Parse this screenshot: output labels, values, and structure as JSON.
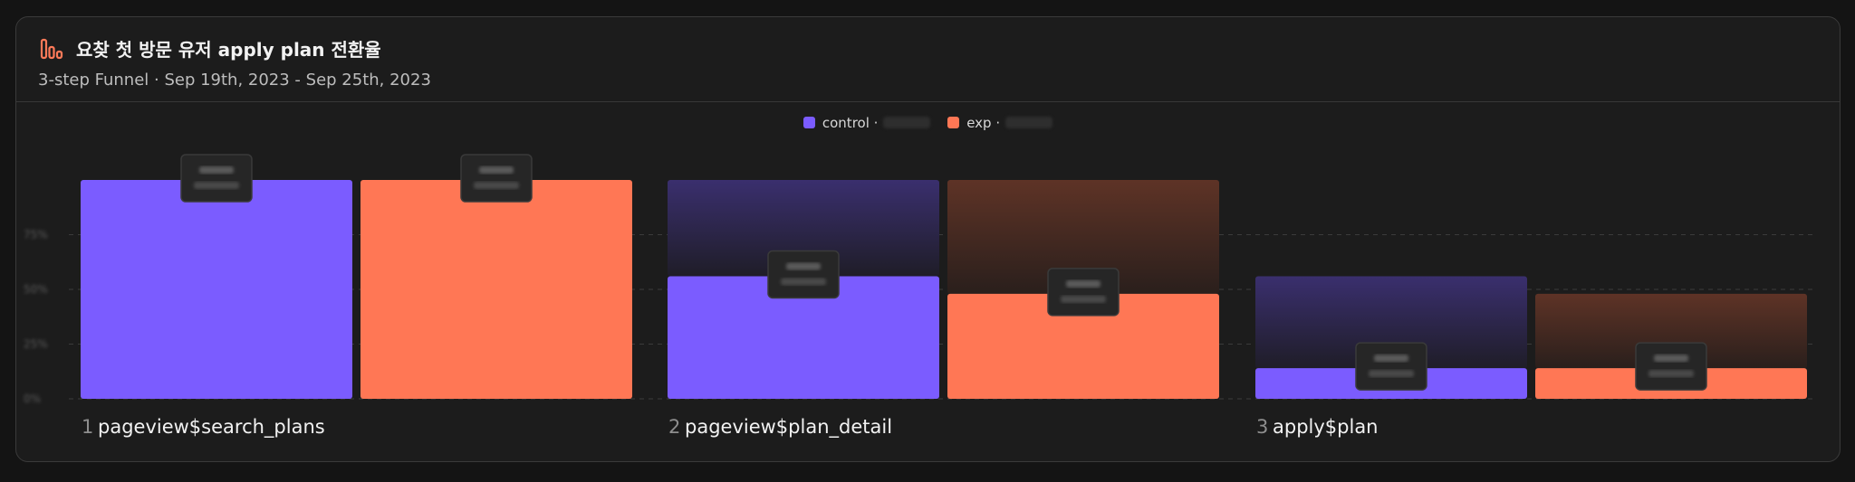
{
  "header": {
    "title": "요찾 첫 방문 유저 apply plan 전환율",
    "subtitle": "3-step Funnel · Sep 19th, 2023 - Sep 25th, 2023",
    "icon": "funnel-chart-icon"
  },
  "chart_data": {
    "type": "bar",
    "categories": [
      "pageview$search_plans",
      "pageview$plan_detail",
      "apply$plan"
    ],
    "step_numbers": [
      "1",
      "2",
      "3"
    ],
    "series": [
      {
        "name": "control",
        "color": "#7b5cff",
        "values": [
          100,
          56,
          14
        ]
      },
      {
        "name": "exp",
        "color": "#ff7755",
        "values": [
          100,
          48,
          14
        ]
      }
    ],
    "ylim": [
      0,
      100
    ],
    "y_ticks": [
      0,
      25,
      50,
      75
    ],
    "grid": true,
    "legend": "top-center",
    "value_labels_blurred": true
  }
}
